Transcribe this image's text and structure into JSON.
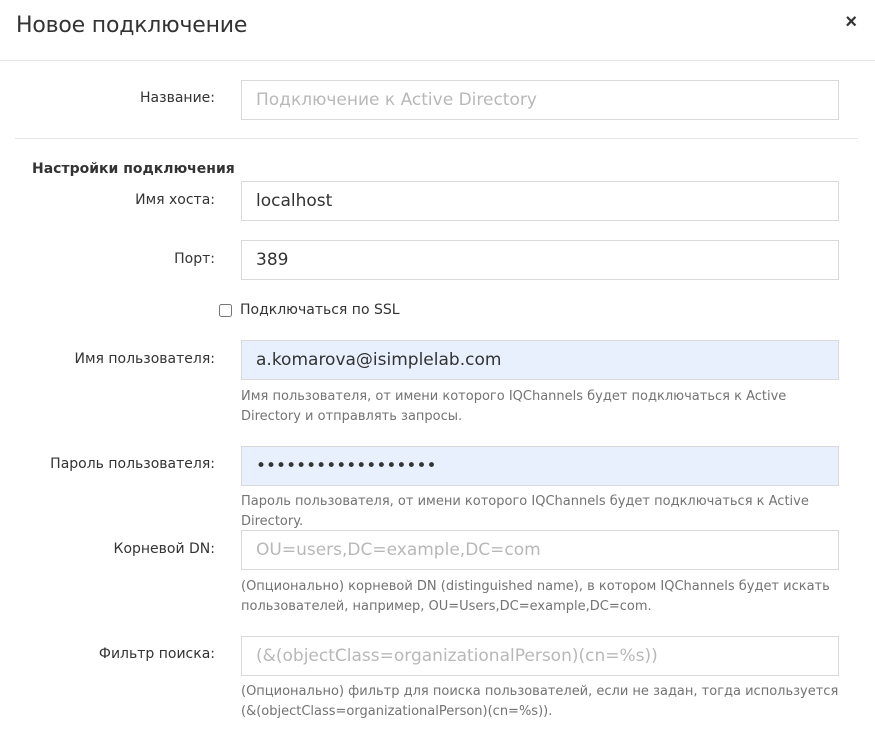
{
  "dialog": {
    "title": "Новое подключение",
    "close_glyph": "×"
  },
  "name_field": {
    "label": "Название:",
    "value": "",
    "placeholder": "Подключение к Active Directory"
  },
  "section_title": "Настройки подключения",
  "host": {
    "label": "Имя хоста:",
    "value": "localhost",
    "placeholder": ""
  },
  "port": {
    "label": "Порт:",
    "value": "389",
    "placeholder": ""
  },
  "ssl": {
    "label": "Подключаться по SSL",
    "checked": false
  },
  "username": {
    "label": "Имя пользователя:",
    "value": "a.komarova@isimplelab.com",
    "help": "Имя пользователя, от имени которого IQChannels будет подключаться к Active Directory и отправлять запросы."
  },
  "password": {
    "label": "Пароль пользователя:",
    "value": "••••••••••••••••••",
    "help": "Пароль пользователя, от имени которого IQChannels будет подключаться к Active Directory."
  },
  "root_dn": {
    "label": "Корневой DN:",
    "value": "",
    "placeholder": "OU=users,DC=example,DC=com",
    "help": "(Опционально) корневой DN (distinguished name), в котором IQChannels будет искать пользователей, например, OU=Users,DC=example,DC=com."
  },
  "search_filter": {
    "label": "Фильтр поиска:",
    "value": "",
    "placeholder": "(&(objectClass=organizationalPerson)(cn=%s))",
    "help": "(Опционально) фильтр для поиска пользователей, если не задан, тогда используется (&(objectClass=organizationalPerson)(cn=%s))."
  },
  "colors": {
    "autofill_bg": "#e8f0fe",
    "border": "#d9d9d9",
    "help_text": "#737373"
  }
}
